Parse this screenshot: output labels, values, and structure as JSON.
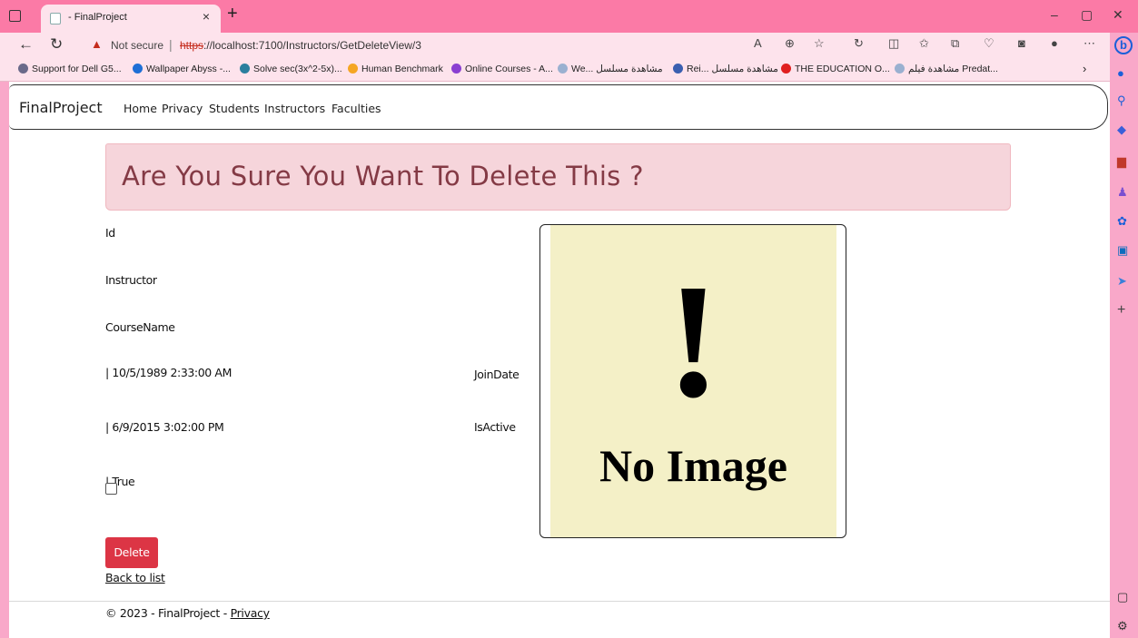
{
  "browser": {
    "tab_title": "- FinalProject",
    "tab_close": "×",
    "new_tab": "+",
    "window_controls": {
      "minimize": "–",
      "maximize": "▢",
      "close": "✕"
    },
    "not_secure": "Not secure",
    "url_scheme": "https",
    "url_rest": "://localhost:7100/Instructors/GetDeleteView/3",
    "bookmarks": [
      {
        "label": "Support for Dell G5...",
        "color": "#6a6a8a"
      },
      {
        "label": "Wallpaper Abyss -...",
        "color": "#1e6fd6"
      },
      {
        "label": "Solve sec(3x^2-5x)...",
        "color": "#2a7f9e"
      },
      {
        "label": "Human Benchmark",
        "color": "#f5a623"
      },
      {
        "label": "Online Courses - A...",
        "color": "#8a3fd1"
      },
      {
        "label": "We... مشاهدة مسلسل",
        "color": "#9ab0d0"
      },
      {
        "label": "Rei... مشاهدة مسلسل",
        "color": "#3a5fb0"
      },
      {
        "label": "THE EDUCATION O...",
        "color": "#e02020"
      },
      {
        "label": "مشاهدة فيلم Predat...",
        "color": "#9ab0d0"
      }
    ]
  },
  "nav": {
    "brand": "FinalProject",
    "links": [
      "Home",
      "Privacy",
      "Students",
      "Instructors",
      "Faculties"
    ]
  },
  "banner": {
    "text": "Are You Sure You Want To Delete This ?"
  },
  "fields": {
    "id_label": "Id",
    "instructor_label": "Instructor",
    "coursename_label": "CourseName",
    "joindate_value": "| 10/5/1989 2:33:00 AM",
    "joindate_label": "JoinDate",
    "isactive_value": "| 6/9/2015 3:02:00 PM",
    "isactive_label": "IsActive",
    "true_value": "| True"
  },
  "image": {
    "exclamation": "!",
    "caption": "No Image"
  },
  "actions": {
    "delete": "Delete",
    "back": "Back to list"
  },
  "footer": {
    "text": "© 2023 - FinalProject - ",
    "privacy": "Privacy"
  },
  "colors": {
    "titlebar": "#fb7aa6",
    "banner_bg": "#f6d5db",
    "banner_text": "#843a45",
    "delete_btn": "#dc3545",
    "image_bg": "#f4f0c7"
  }
}
